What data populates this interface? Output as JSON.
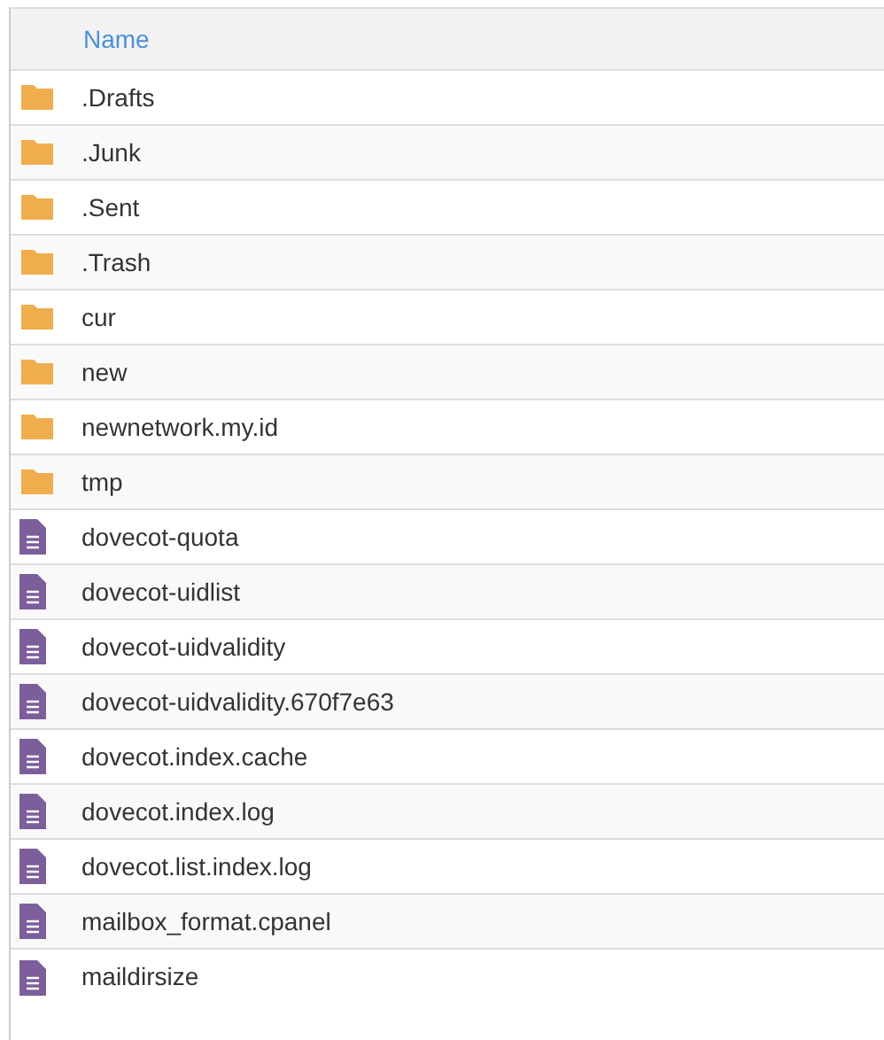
{
  "table": {
    "columns": [
      "Name"
    ],
    "rows": [
      {
        "kind": "folder",
        "name": ".Drafts"
      },
      {
        "kind": "folder",
        "name": ".Junk"
      },
      {
        "kind": "folder",
        "name": ".Sent"
      },
      {
        "kind": "folder",
        "name": ".Trash"
      },
      {
        "kind": "folder",
        "name": "cur"
      },
      {
        "kind": "folder",
        "name": "new"
      },
      {
        "kind": "folder",
        "name": "newnetwork.my.id"
      },
      {
        "kind": "folder",
        "name": "tmp"
      },
      {
        "kind": "file",
        "name": "dovecot-quota"
      },
      {
        "kind": "file",
        "name": "dovecot-uidlist"
      },
      {
        "kind": "file",
        "name": "dovecot-uidvalidity"
      },
      {
        "kind": "file",
        "name": "dovecot-uidvalidity.670f7e63"
      },
      {
        "kind": "file",
        "name": "dovecot.index.cache"
      },
      {
        "kind": "file",
        "name": "dovecot.index.log"
      },
      {
        "kind": "file",
        "name": "dovecot.list.index.log"
      },
      {
        "kind": "file",
        "name": "mailbox_format.cpanel"
      },
      {
        "kind": "file",
        "name": "maildirsize"
      }
    ]
  }
}
